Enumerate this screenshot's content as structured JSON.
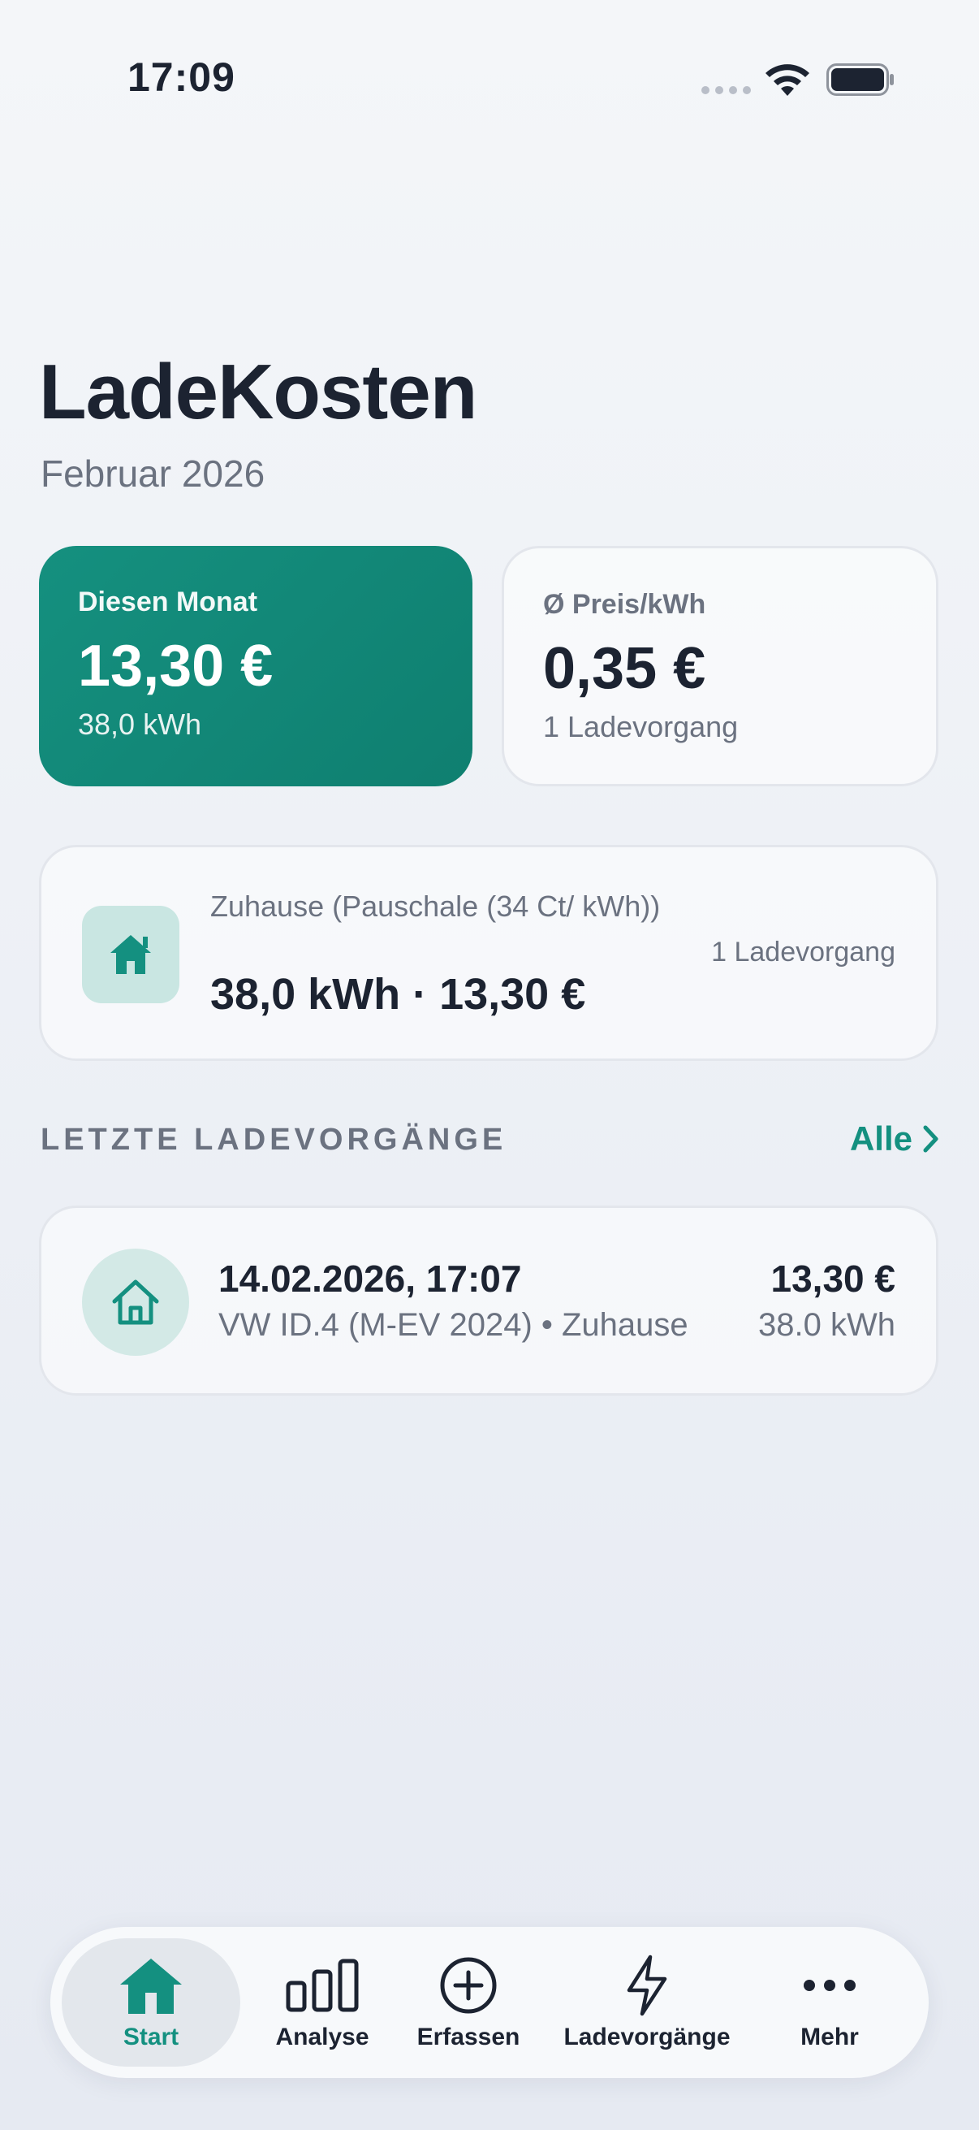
{
  "status_bar": {
    "time": "17:09"
  },
  "header": {
    "title": "LadeKosten",
    "subtitle": "Februar 2026"
  },
  "summary": {
    "month": {
      "label": "Diesen Monat",
      "value": "13,30 €",
      "sub": "38,0 kWh"
    },
    "price": {
      "label": "Ø Preis/kWh",
      "value": "0,35 €",
      "sub": "1 Ladevorgang"
    }
  },
  "location": {
    "icon": "house-icon",
    "name": "Zuhause (Pauschale (34 Ct/ kWh))",
    "value": "38,0 kWh · 13,30 €",
    "count": "1 Ladevorgang"
  },
  "recent": {
    "title": "LETZTE LADEVORGÄNGE",
    "link": "Alle",
    "sessions": [
      {
        "icon": "house-outline-icon",
        "date": "14.02.2026, 17:07",
        "meta": "VW ID.4 (M-EV 2024) • Zuhause",
        "cost": "13,30 €",
        "energy": "38.0 kWh"
      }
    ]
  },
  "tab_bar": {
    "tabs": [
      {
        "label": "Start",
        "icon": "home-icon",
        "active": true
      },
      {
        "label": "Analyse",
        "icon": "bar-chart-icon"
      },
      {
        "label": "Erfassen",
        "icon": "plus-circle-icon"
      },
      {
        "label": "Ladevorgänge",
        "icon": "bolt-icon"
      },
      {
        "label": "Mehr",
        "icon": "more-icon"
      }
    ]
  },
  "colors": {
    "accent": "#149080",
    "card_accent": "#12897a",
    "text": "#1c2331",
    "muted": "#6b7280"
  }
}
